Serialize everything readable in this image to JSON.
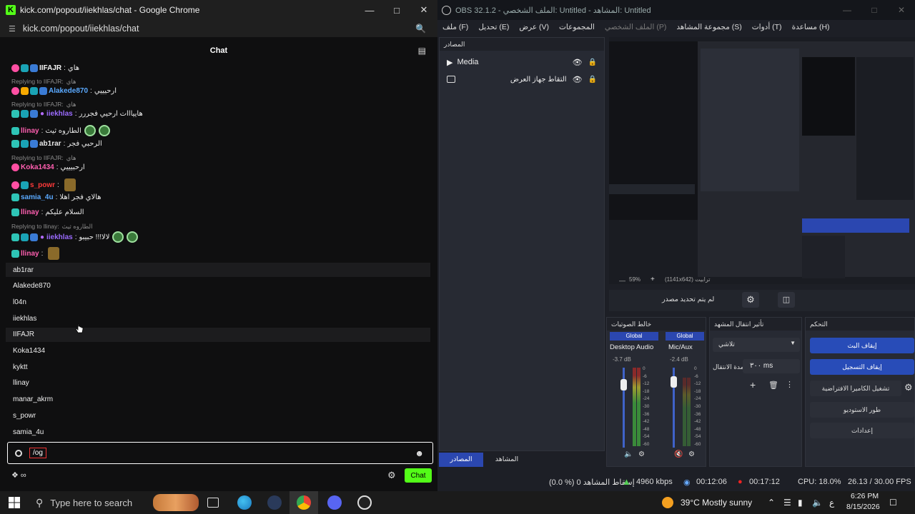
{
  "chrome": {
    "window_title": "kick.com/popout/iiekhlas/chat - Google Chrome",
    "url": "kick.com/popout/iiekhlas/chat",
    "chat_title": "Chat"
  },
  "messages": [
    {
      "user": "IIFAJR",
      "text": "هاي",
      "color": "#f4f4f4",
      "badges": [
        "b-pink",
        "b-teal",
        "b-blue"
      ]
    },
    {
      "reply": "Replying to IIFAJR:",
      "reply_text": "هاي"
    },
    {
      "user": "Alakede870",
      "text": "ارحيييي",
      "color": "#5aa9ff",
      "badges": [
        "b-pink",
        "b-gold",
        "b-teal",
        "b-blue"
      ]
    },
    {
      "reply": "Replying to IIFAJR:",
      "reply_text": "هاي"
    },
    {
      "user": "iiekhlas",
      "text": "هاييااات ارحيي فجررر",
      "color": "#9b6bff",
      "badges": [
        "b-sub",
        "b-teal",
        "b-blue",
        "b-mic"
      ]
    },
    {
      "user": "llinay",
      "text": "الطاروه ثيث",
      "color": "#ff5fb0",
      "badges": [
        "b-sub"
      ]
    },
    {
      "user": "ab1rar",
      "text": "الرحبي فجر",
      "color": "#e8e8e8",
      "badges": [
        "b-sub",
        "b-teal",
        "b-blue"
      ]
    },
    {
      "reply": "Replying to IIFAJR:",
      "reply_text": "هاي"
    },
    {
      "user": "Koka1434",
      "text": "ارحبيييي",
      "color": "#ff5fb0",
      "badges": [
        "b-pink"
      ]
    },
    {
      "user": "s_powr",
      "text": "",
      "color": "#ff3a3a",
      "badges": [
        "b-pink",
        "b-teal"
      ]
    },
    {
      "user": "samia_4u",
      "text": "هالاي فجر اهلا",
      "color": "#5aa9ff",
      "badges": [
        "b-sub"
      ]
    },
    {
      "user": "llinay",
      "text": "السلام عليكم",
      "color": "#ff5fb0",
      "badges": [
        "b-sub"
      ]
    },
    {
      "reply": "Replying to llinay:",
      "reply_text": "الطاروه ثيث"
    },
    {
      "user": "iiekhlas",
      "text": "لالا!!! حبيبو",
      "color": "#9b6bff",
      "badges": [
        "b-sub",
        "b-teal",
        "b-blue",
        "b-mic"
      ]
    },
    {
      "user": "llinay",
      "text": "",
      "color": "#ff5fb0",
      "badges": [
        "b-sub"
      ]
    }
  ],
  "suggestions": [
    "ab1rar",
    "Alakede870",
    "l04n",
    "iiekhlas",
    "IIFAJR",
    "Koka1434",
    "kyktt",
    "llinay",
    "manar_akrm",
    "s_powr",
    "samia_4u"
  ],
  "chat_input": {
    "value": "/og",
    "send_label": "Chat"
  },
  "obs": {
    "window_title": "OBS 32.1.2 - الملف الشخصي: Untitled - المشاهد: Untitled",
    "menu": [
      "ملف (F)",
      "تحديل (E)",
      "عرض (V)",
      "المجموعات",
      "الملف الشخصي (P)",
      "مجموعة المشاهد (S)",
      "أدوات (T)",
      "مساعدة (H)"
    ],
    "sources_title": "المصادر",
    "sources": [
      {
        "name": "Media"
      },
      {
        "name": "التقاط جهاز العرض"
      }
    ],
    "zoom_text": "59%",
    "resolution_text": "(1141x642) ترابيت",
    "no_source": "لم يتم تحديد مصدر",
    "mixer_title": "خالط الصوتيات",
    "transition_title": "تأثير انتقال المشهد",
    "controls_title": "التحكم",
    "mixer": [
      {
        "label": "Global",
        "name": "Desktop Audio",
        "db": "-3.7 dB"
      },
      {
        "label": "Global",
        "name": "Mic/Aux",
        "db": "-2.4 dB"
      }
    ],
    "meter_ticks": [
      "0",
      "-6",
      "-12",
      "-18",
      "-24",
      "-30",
      "-36",
      "-42",
      "-48",
      "-54",
      "-60"
    ],
    "transition": {
      "type": "تلاشي",
      "duration_label": "مدة الانتقال",
      "duration": "٣٠٠ ms"
    },
    "controls": [
      "إيقاف البث",
      "إيقاف التسجيل",
      "تشغيل الكاميرا الافتراضية",
      "طور الاستوديو",
      "إعدادات"
    ],
    "tabs": [
      "المصادر",
      "المشاهد"
    ],
    "status": {
      "dropped": "(0.0 %) إسقاط المشاهد 0",
      "bitrate": "4960 kbps",
      "stream_time": "00:12:06",
      "rec_time": "00:17:12",
      "cpu": "CPU: 18.0%",
      "fps": "26.13 / 30.00 FPS"
    }
  },
  "taskbar": {
    "search_placeholder": "Type here to search",
    "weather": "39°C  Mostly sunny",
    "lang": "ع",
    "time": "6:26 PM",
    "date": "8/15/2026"
  }
}
